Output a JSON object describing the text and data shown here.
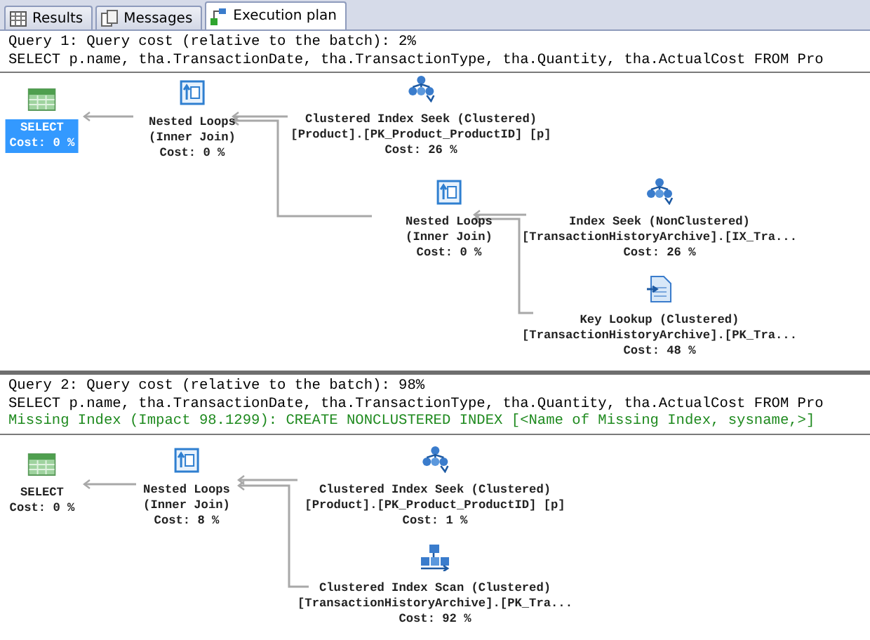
{
  "tabs": [
    {
      "label": "Results",
      "selected": false,
      "kind": "grid"
    },
    {
      "label": "Messages",
      "selected": false,
      "kind": "messages"
    },
    {
      "label": "Execution plan",
      "selected": true,
      "kind": "plan"
    }
  ],
  "queries": [
    {
      "title": "Query 1: Query cost (relative to the batch): 2%",
      "sql": "SELECT p.name, tha.TransactionDate, tha.TransactionType, tha.Quantity, tha.ActualCost FROM Pro",
      "nodes": [
        {
          "kind": "select",
          "lines": [
            "SELECT",
            "Cost: 0 %"
          ],
          "selected": true
        },
        {
          "kind": "nested_loops",
          "lines": [
            "Nested Loops",
            "(Inner Join)",
            "Cost: 0 %"
          ],
          "selected": false
        },
        {
          "kind": "clustered_seek",
          "lines": [
            "Clustered Index Seek (Clustered)",
            "[Product].[PK_Product_ProductID] [p]",
            "Cost: 26 %"
          ],
          "selected": false
        },
        {
          "kind": "nested_loops",
          "lines": [
            "Nested Loops",
            "(Inner Join)",
            "Cost: 0 %"
          ],
          "selected": false
        },
        {
          "kind": "index_seek",
          "lines": [
            "Index Seek (NonClustered)",
            "[TransactionHistoryArchive].[IX_Tra...",
            "Cost: 26 %"
          ],
          "selected": false
        },
        {
          "kind": "key_lookup",
          "lines": [
            "Key Lookup (Clustered)",
            "[TransactionHistoryArchive].[PK_Tra...",
            "Cost: 48 %"
          ],
          "selected": false
        }
      ]
    },
    {
      "title": "Query 2: Query cost (relative to the batch): 98%",
      "sql": "SELECT p.name, tha.TransactionDate, tha.TransactionType, tha.Quantity, tha.ActualCost FROM Pro",
      "missing_index": "Missing Index (Impact 98.1299): CREATE NONCLUSTERED INDEX [<Name of Missing Index, sysname,>]",
      "nodes": [
        {
          "kind": "select",
          "lines": [
            "SELECT",
            "Cost: 0 %"
          ],
          "selected": false
        },
        {
          "kind": "nested_loops",
          "lines": [
            "Nested Loops",
            "(Inner Join)",
            "Cost: 8 %"
          ],
          "selected": false
        },
        {
          "kind": "clustered_seek",
          "lines": [
            "Clustered Index Seek (Clustered)",
            "[Product].[PK_Product_ProductID] [p]",
            "Cost: 1 %"
          ],
          "selected": false
        },
        {
          "kind": "clustered_scan",
          "lines": [
            "Clustered Index Scan (Clustered)",
            "[TransactionHistoryArchive].[PK_Tra...",
            "Cost: 92 %"
          ],
          "selected": false
        }
      ]
    }
  ]
}
